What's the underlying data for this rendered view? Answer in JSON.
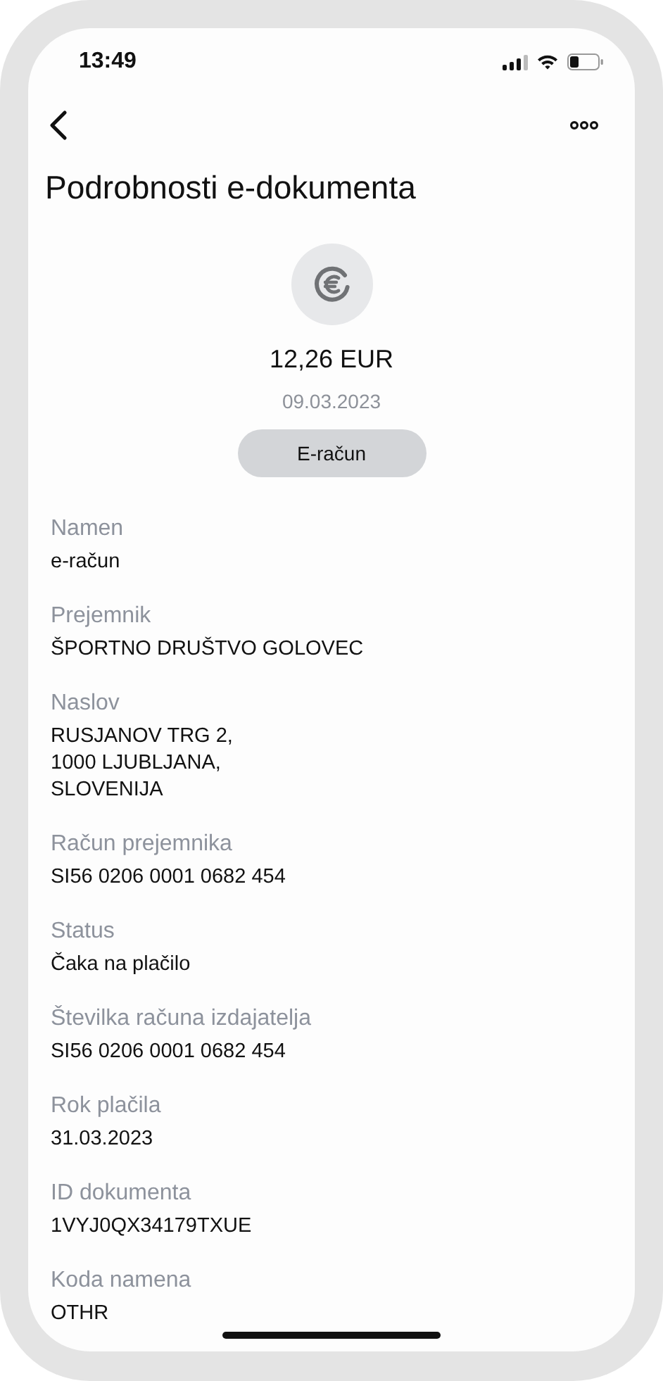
{
  "status_bar": {
    "time": "13:49"
  },
  "header": {
    "title": "Podrobnosti e-dokumenta"
  },
  "summary": {
    "amount": "12,26 EUR",
    "date": "09.03.2023",
    "type_button": "E-račun"
  },
  "fields": [
    {
      "label": "Namen",
      "value": "e-račun"
    },
    {
      "label": "Prejemnik",
      "value": "ŠPORTNO DRUŠTVO GOLOVEC"
    },
    {
      "label": "Naslov",
      "value": "RUSJANOV TRG 2,\n1000 LJUBLJANA,\nSLOVENIJA"
    },
    {
      "label": "Račun prejemnika",
      "value": "SI56 0206 0001 0682 454"
    },
    {
      "label": "Status",
      "value": "Čaka na plačilo"
    },
    {
      "label": "Številka računa izdajatelja",
      "value": "SI56 0206 0001 0682 454"
    },
    {
      "label": "Rok plačila",
      "value": "31.03.2023"
    },
    {
      "label": "ID dokumenta",
      "value": "1VYJ0QX34179TXUE"
    },
    {
      "label": "Koda namena",
      "value": "OTHR"
    }
  ]
}
